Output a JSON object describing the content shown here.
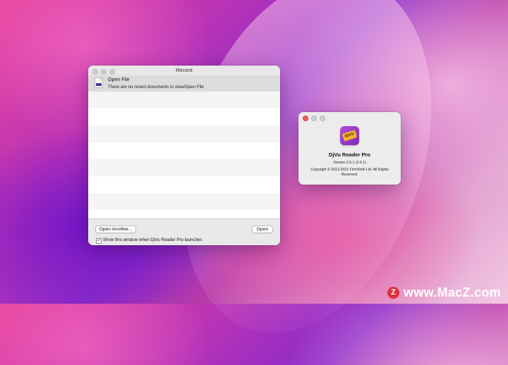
{
  "recent_window": {
    "title": "Recent",
    "items": [
      {
        "icon": "djvu-file-icon",
        "title": "Open File",
        "subtitle": "There are no recent documents to view/Open File"
      }
    ],
    "buttons": {
      "open_another": "Open Another...",
      "open": "Open"
    },
    "checkbox": {
      "label": "Show this window when DjVu Reader Pro launches",
      "checked": true
    }
  },
  "about_window": {
    "app_name": "DjVu Reader Pro",
    "version": "Version 2.6.1 (2.6.1)",
    "copyright": "Copyright © 2013-2021 FirmShell Ltd. All Rights Reserved.",
    "icon_text": "DJVU"
  },
  "watermark": {
    "logo": "Z",
    "text": "www.MacZ.com"
  },
  "colors": {
    "close_red": "#ec5f57",
    "icon_purple": "#9a3fcf",
    "icon_tag": "#f3b62b",
    "watermark_red": "#e0303f"
  }
}
